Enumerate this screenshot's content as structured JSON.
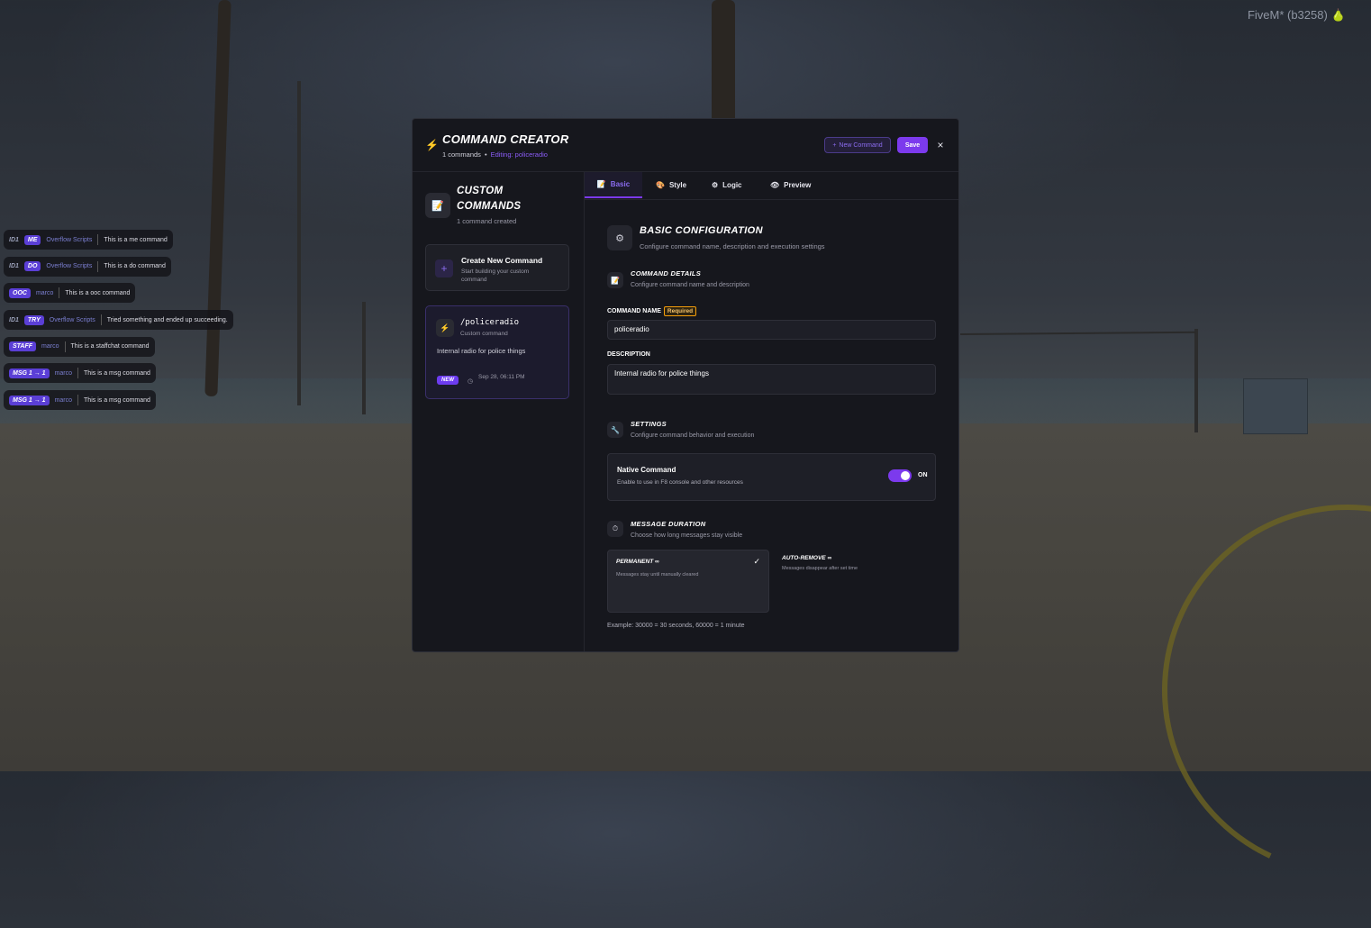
{
  "watermark": "FiveM* (b3258)",
  "chat": [
    {
      "id": "ID1",
      "tag": "ME",
      "tag_color": "#5b3fd6",
      "author": "Overflow Scripts",
      "message": "This is a me command"
    },
    {
      "id": "ID1",
      "tag": "DO",
      "tag_color": "#5b3fd6",
      "author": "Overflow Scripts",
      "message": "This is a do command"
    },
    {
      "id": "",
      "tag": "OOC",
      "tag_color": "#5b3fd6",
      "author": "marco",
      "message": "This is a ooc command"
    },
    {
      "id": "ID1",
      "tag": "TRY",
      "tag_color": "#5b3fd6",
      "author": "Overflow Scripts",
      "message": "Tried something and ended up succeeding."
    },
    {
      "id": "",
      "tag": "STAFF",
      "tag_color": "#5b3fd6",
      "author": "marco",
      "message": "This is a staffchat command"
    },
    {
      "id": "",
      "tag": "MSG 1 → 1",
      "tag_color": "#5b3fd6",
      "author": "marco",
      "message": "This is a msg command"
    },
    {
      "id": "",
      "tag": "MSG 1 → 1",
      "tag_color": "#5b3fd6",
      "author": "marco",
      "message": "This is a msg command"
    }
  ],
  "header": {
    "title": "COMMAND CREATOR",
    "count": "1 commands",
    "separator": "•",
    "editing": "Editing: policeradio",
    "new_command": "New Command",
    "save": "Save",
    "close": "×"
  },
  "sidebar": {
    "title_line1": "CUSTOM",
    "title_line2": "COMMANDS",
    "count": "1 command created",
    "create_title": "Create New Command",
    "create_sub": "Start building your custom command",
    "command": {
      "name": "/policeradio",
      "type": "Custom command",
      "description": "Internal radio for police things",
      "badge": "NEW",
      "date": "Sep 28, 06:11 PM"
    }
  },
  "tabs": [
    {
      "label": "Basic"
    },
    {
      "label": "Style"
    },
    {
      "label": "Logic"
    },
    {
      "label": "Preview"
    }
  ],
  "basic": {
    "title": "BASIC CONFIGURATION",
    "subtitle": "Configure command name, description and execution settings",
    "details_title": "COMMAND DETAILS",
    "details_sub": "Configure command name and description",
    "name_label": "COMMAND NAME",
    "required": "Required",
    "name_value": "policeradio",
    "desc_label": "DESCRIPTION",
    "desc_value": "Internal radio for police things",
    "settings_title": "SETTINGS",
    "settings_sub": "Configure command behavior and execution",
    "native_title": "Native Command",
    "native_sub": "Enable to use in F8 console and other resources",
    "native_state": "ON",
    "duration_title": "MESSAGE DURATION",
    "duration_sub": "Choose how long messages stay visible",
    "opt_permanent": "PERMANENT ∞",
    "opt_permanent_sub": "Messages stay until manually cleared",
    "opt_auto": "AUTO-REMOVE ∞",
    "opt_auto_sub": "Messages disappear after set time",
    "example": "Example: 30000 = 30 seconds, 60000 = 1 minute"
  },
  "colors": {
    "accent": "#7c3aed",
    "bolt": "#f59e0b",
    "required": "#f59e0b"
  }
}
